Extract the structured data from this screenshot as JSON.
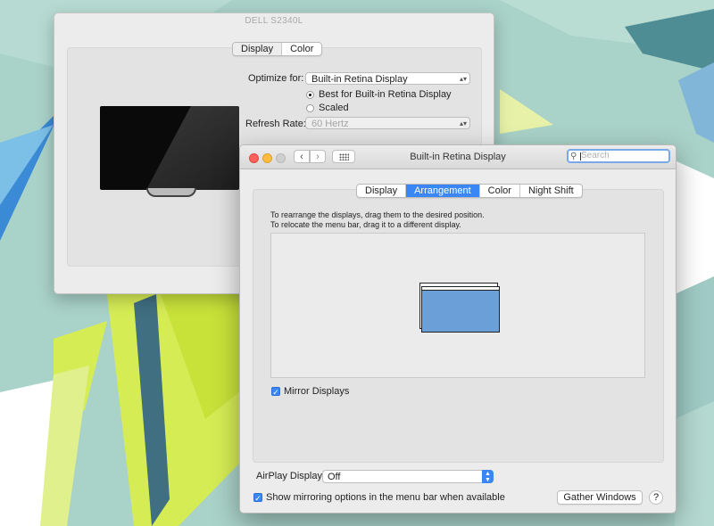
{
  "back_window": {
    "title": "DELL S2340L",
    "tabs": [
      {
        "label": "Display",
        "selected": true
      },
      {
        "label": "Color",
        "selected": false
      }
    ],
    "optimize_label": "Optimize for:",
    "optimize_value": "Built-in Retina Display",
    "radio_best": "Best for Built-in Retina Display",
    "radio_scaled": "Scaled",
    "refresh_label": "Refresh Rate:",
    "refresh_value": "60 Hertz"
  },
  "front_window": {
    "title": "Built-in Retina Display",
    "search_placeholder": "Search",
    "tabs": [
      {
        "label": "Display",
        "active": false
      },
      {
        "label": "Arrangement",
        "active": true
      },
      {
        "label": "Color",
        "active": false
      },
      {
        "label": "Night Shift",
        "active": false
      }
    ],
    "instruction_1": "To rearrange the displays, drag them to the desired position.",
    "instruction_2": "To relocate the menu bar, drag it to a different display.",
    "mirror_label": "Mirror Displays",
    "mirror_checked": true,
    "airplay_label": "AirPlay Display:",
    "airplay_value": "Off",
    "show_mirroring_label": "Show mirroring options in the menu bar when available",
    "show_mirroring_checked": true,
    "gather_button": "Gather Windows",
    "help_label": "?"
  },
  "colors": {
    "accent": "#3b86f5",
    "display_fill": "#6b9fd8",
    "desktop": "#a9d2c8"
  }
}
